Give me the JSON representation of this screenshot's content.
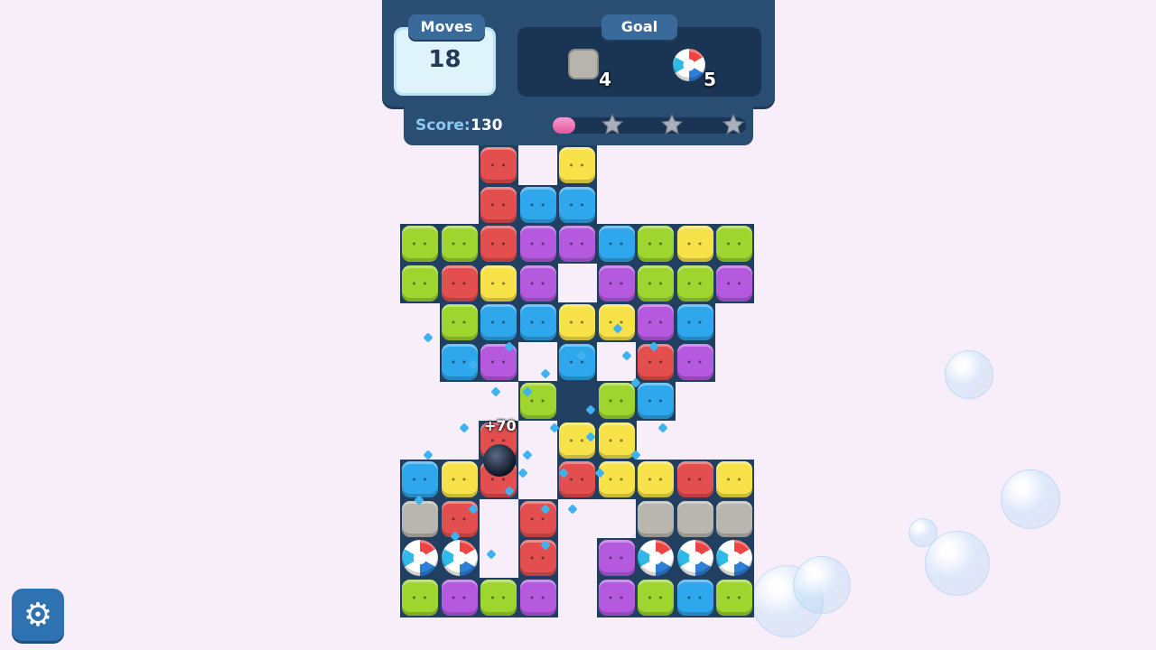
{
  "hud": {
    "moves_label": "Moves",
    "moves_value": "18",
    "goal_label": "Goal",
    "goals": [
      {
        "icon": "stone-block-icon",
        "count": "4"
      },
      {
        "icon": "beach-ball-icon",
        "count": "5"
      }
    ],
    "score_label": "Score:",
    "score_value": "130",
    "score_progress": 0.08,
    "stars": 3
  },
  "effects": {
    "combo_text": "+70"
  },
  "colors": {
    "green": "#9ed52f",
    "red": "#e34f4f",
    "yellow": "#f8e24a",
    "blue": "#2fa7ec",
    "purple": "#b55adf",
    "stone": "#b9b6b0",
    "hud": "#2a4d72",
    "background": "#f7eefa"
  },
  "board": {
    "rows": [
      "..R.Y....",
      "..RBB....",
      "GGRPPBGYG",
      "GRYP.PGGP",
      ".GBBYYPB.",
      ".BP.B.RP.",
      "...GXGB..",
      "..R.YY...",
      "BYR.RYYRY",
      "SR.R..SSS",
      "OO.R.POOO",
      "GPGP.PGBG"
    ]
  },
  "settings": {
    "icon": "gear-icon"
  }
}
